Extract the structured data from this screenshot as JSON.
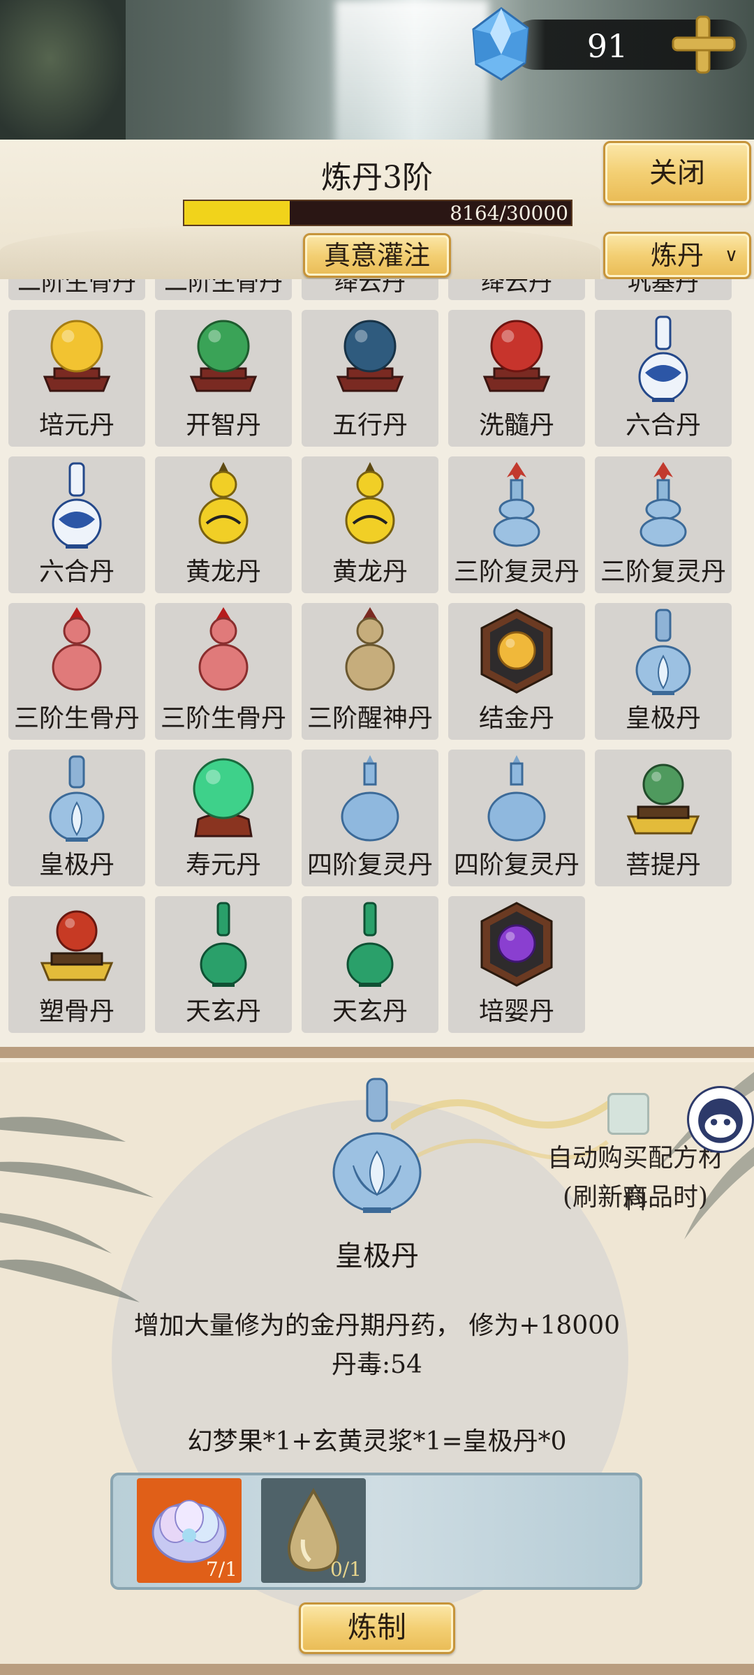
{
  "currency": {
    "amount": "91",
    "icon": "blue-crystal-icon",
    "add_icon": "plus-icon"
  },
  "header": {
    "title": "炼丹3阶",
    "progress": {
      "current": 8164,
      "max": 30000,
      "fraction": 0.2721,
      "text": "8164/30000"
    },
    "close_label": "关闭",
    "infuse_label": "真意灌注",
    "mode_value": "炼丹",
    "mode_icon": "chevron-down-icon"
  },
  "partial_row": [
    "二阶生骨丹",
    "二阶生骨丹",
    "绛云丹",
    "绛云丹",
    "巩基丹"
  ],
  "items": [
    {
      "label": "培元丹",
      "icon": "yellow-pill-on-stand-icon"
    },
    {
      "label": "开智丹",
      "icon": "green-pill-on-stand-icon"
    },
    {
      "label": "五行丹",
      "icon": "blue-pill-on-stand-icon"
    },
    {
      "label": "洗髓丹",
      "icon": "red-pill-on-stand-icon"
    },
    {
      "label": "六合丹",
      "icon": "blue-white-vase-icon"
    },
    {
      "label": "六合丹",
      "icon": "blue-white-vase-icon"
    },
    {
      "label": "黄龙丹",
      "icon": "yellow-gourd-icon"
    },
    {
      "label": "黄龙丹",
      "icon": "yellow-gourd-icon"
    },
    {
      "label": "三阶复灵丹",
      "icon": "blue-vase-with-flower-icon"
    },
    {
      "label": "三阶复灵丹",
      "icon": "blue-vase-with-flower-icon"
    },
    {
      "label": "三阶生骨丹",
      "icon": "pink-gourd-icon"
    },
    {
      "label": "三阶生骨丹",
      "icon": "pink-gourd-icon"
    },
    {
      "label": "三阶醒神丹",
      "icon": "tan-gourd-icon"
    },
    {
      "label": "结金丹",
      "icon": "gold-pill-box-icon"
    },
    {
      "label": "皇极丹",
      "icon": "lotus-vase-icon"
    },
    {
      "label": "皇极丹",
      "icon": "lotus-vase-icon"
    },
    {
      "label": "寿元丹",
      "icon": "jade-orb-on-stand-icon"
    },
    {
      "label": "四阶复灵丹",
      "icon": "light-blue-bottle-icon"
    },
    {
      "label": "四阶复灵丹",
      "icon": "light-blue-bottle-icon"
    },
    {
      "label": "菩提丹",
      "icon": "green-pill-on-gold-stand-icon"
    },
    {
      "label": "塑骨丹",
      "icon": "red-pill-on-gold-stand-icon"
    },
    {
      "label": "天玄丹",
      "icon": "green-vase-icon"
    },
    {
      "label": "天玄丹",
      "icon": "green-vase-icon"
    },
    {
      "label": "培婴丹",
      "icon": "purple-pill-box-icon"
    }
  ],
  "detail": {
    "icon": "lotus-vase-icon",
    "name": "皇极丹",
    "description": "增加大量修为的金丹期丹药，  修为+18000",
    "toxicity": "丹毒:54",
    "formula": "幻梦果*1+玄黄灵浆*1=皇极丹*0",
    "auto_buy_label": "自动购买配方材料",
    "auto_buy_sub": "(刷新商品时)",
    "auto_buy_checked": false,
    "materials": [
      {
        "icon": "dream-fruit-flower-icon",
        "count": "7/1"
      },
      {
        "icon": "golden-droplet-icon",
        "count": "0/1"
      }
    ],
    "craft_label": "炼制"
  }
}
